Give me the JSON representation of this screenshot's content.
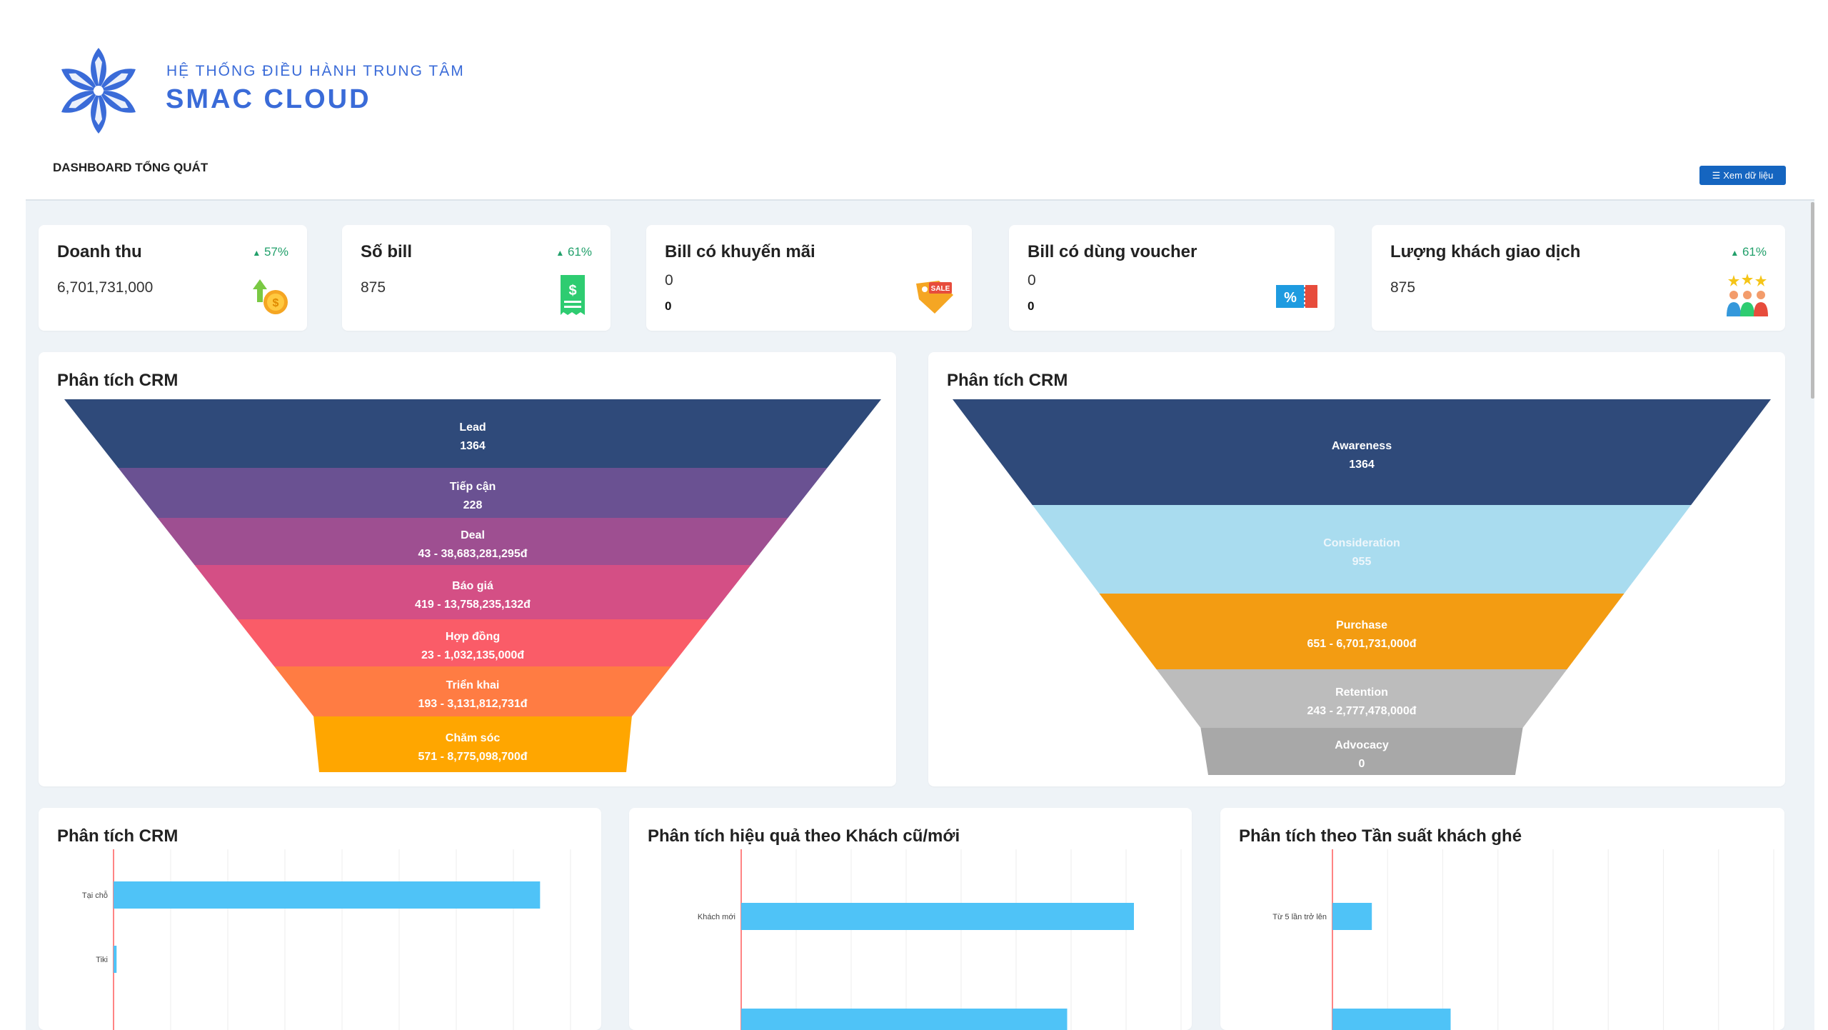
{
  "header": {
    "brand_subtitle": "HỆ THỐNG ĐIỀU HÀNH TRUNG TÂM",
    "brand_title": "SMAC CLOUD",
    "page_title": "DASHBOARD TỔNG QUÁT",
    "view_data_button": "Xem dữ liệu"
  },
  "colors": {
    "accent": "#3a6bd8",
    "button": "#1565c0",
    "positive": "#22a06b",
    "bar": "#4fc3f7"
  },
  "kpis": [
    {
      "title": "Doanh thu",
      "value": "6,701,731,000",
      "change": "57%",
      "icon": "revenue-coin-icon"
    },
    {
      "title": "Số bill",
      "value": "875",
      "change": "61%",
      "icon": "bill-receipt-icon"
    },
    {
      "title": "Bill có khuyến mãi",
      "value": "0",
      "sub": "0",
      "icon": "sale-tag-icon"
    },
    {
      "title": "Bill có dùng voucher",
      "value": "0",
      "sub": "0",
      "icon": "voucher-icon"
    },
    {
      "title": "Lượng khách giao dịch",
      "value": "875",
      "change": "61%",
      "icon": "customers-stars-icon"
    }
  ],
  "panels": {
    "crm_funnel_title": "Phân tích CRM",
    "aida_funnel_title": "Phân tích CRM",
    "channel_bar_title": "Phân tích CRM",
    "customer_type_title": "Phân tích hiệu quả theo Khách cũ/mới",
    "visit_frequency_title": "Phân tích theo Tần suất khách ghé"
  },
  "chart_data": [
    {
      "type": "funnel",
      "stages": [
        {
          "name": "Lead",
          "label": "1364",
          "value": 1364,
          "color": "#2f4a7a"
        },
        {
          "name": "Tiếp cận",
          "label": "228",
          "value": 228,
          "color": "#6a5192"
        },
        {
          "name": "Deal",
          "label": "43 - 38,683,281,295đ",
          "value": 43,
          "color": "#9e4f91"
        },
        {
          "name": "Báo giá",
          "label": "419 - 13,758,235,132đ",
          "value": 419,
          "color": "#d44f85"
        },
        {
          "name": "Hợp đồng",
          "label": "23 - 1,032,135,000đ",
          "value": 23,
          "color": "#fa5c68"
        },
        {
          "name": "Triển khai",
          "label": "193 - 3,131,812,731đ",
          "value": 193,
          "color": "#ff7c43"
        },
        {
          "name": "Chăm sóc",
          "label": "571 - 8,775,098,700đ",
          "value": 571,
          "color": "#ffa600"
        }
      ]
    },
    {
      "type": "funnel",
      "stages": [
        {
          "name": "Awareness",
          "label": "1364",
          "value": 1364,
          "color": "#2f4a7a"
        },
        {
          "name": "Consideration",
          "label": "955",
          "value": 955,
          "color": "#a9dcef"
        },
        {
          "name": "Purchase",
          "label": "651 - 6,701,731,000đ",
          "value": 651,
          "color": "#f39c12"
        },
        {
          "name": "Retention",
          "label": "243 - 2,777,478,000đ",
          "value": 243,
          "color": "#bcbcbc"
        },
        {
          "name": "Advocacy",
          "label": "0",
          "value": 0,
          "color": "#a8a8a8"
        }
      ]
    },
    {
      "type": "bar",
      "orientation": "horizontal",
      "categories": [
        "Tại chỗ",
        "Tiki"
      ],
      "values": [
        560,
        4
      ],
      "xlim": [
        0,
        600
      ],
      "grid": true
    },
    {
      "type": "bar",
      "orientation": "horizontal",
      "categories": [
        "Khách mới",
        ""
      ],
      "values": [
        500,
        415
      ],
      "xlim": [
        0,
        560
      ],
      "grid": true
    },
    {
      "type": "bar",
      "orientation": "horizontal",
      "categories": [
        "Từ 5 lần trở lên",
        ""
      ],
      "values": [
        50,
        150
      ],
      "xlim": [
        0,
        560
      ],
      "grid": true
    }
  ]
}
